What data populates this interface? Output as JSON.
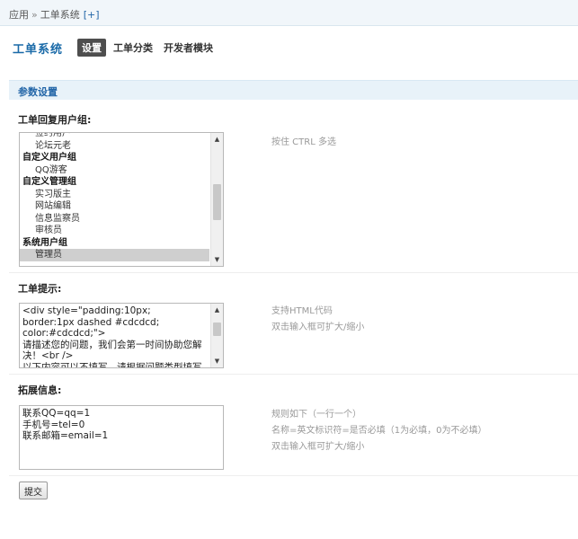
{
  "breadcrumb": {
    "root": "应用",
    "separator": "»",
    "current": "工单系统",
    "add": "[+]"
  },
  "nav": {
    "title": "工单系统",
    "tabs": [
      {
        "label": "设置",
        "active": true
      },
      {
        "label": "工单分类",
        "active": false
      },
      {
        "label": "开发者模块",
        "active": false
      }
    ]
  },
  "section": {
    "title": "参数设置"
  },
  "admin_groups": {
    "label": "工单回复用户组:",
    "hint": "按住 CTRL 多选",
    "options": [
      {
        "text": "签约用户",
        "type": "item",
        "selected": false
      },
      {
        "text": "论坛元老",
        "type": "item",
        "selected": false
      },
      {
        "text": "自定义用户组",
        "type": "group",
        "selected": false
      },
      {
        "text": "QQ游客",
        "type": "item",
        "selected": false
      },
      {
        "text": "自定义管理组",
        "type": "group",
        "selected": false
      },
      {
        "text": "实习版主",
        "type": "item",
        "selected": false
      },
      {
        "text": "网站编辑",
        "type": "item",
        "selected": false
      },
      {
        "text": "信息监察员",
        "type": "item",
        "selected": false
      },
      {
        "text": "审核员",
        "type": "item",
        "selected": false
      },
      {
        "text": "系统用户组",
        "type": "group",
        "selected": false
      },
      {
        "text": "管理员",
        "type": "item",
        "selected": true
      }
    ],
    "scroll": {
      "thumb_start": 0.36,
      "thumb_end": 0.69
    }
  },
  "ticket_tip": {
    "label": "工单提示:",
    "value": "<div style=\"padding:10px;\nborder:1px dashed #cdcdcd;\ncolor:#cdcdcd;\">\n请描述您的问题，我们会第一时间协助您解决！<br />\n以下内容可以不填写，请根据问题类型填写",
    "hints": [
      "支持HTML代码",
      "双击输入框可扩大/缩小"
    ],
    "scroll": {
      "thumb_start": 0.18,
      "thumb_end": 0.52
    }
  },
  "extra_info": {
    "label": "拓展信息:",
    "value": "联系QQ=qq=1\n手机号=tel=0\n联系邮箱=email=1",
    "hints": [
      "规则如下（一行一个）",
      "名称=英文标识符=是否必填（1为必填，0为不必填）",
      "双击输入框可扩大/缩小"
    ]
  },
  "submit": {
    "label": "提交"
  },
  "colors": {
    "accent": "#1a6aa8",
    "section_bg": "#e8f2f9",
    "active_tab_bg": "#4e4e4e"
  }
}
